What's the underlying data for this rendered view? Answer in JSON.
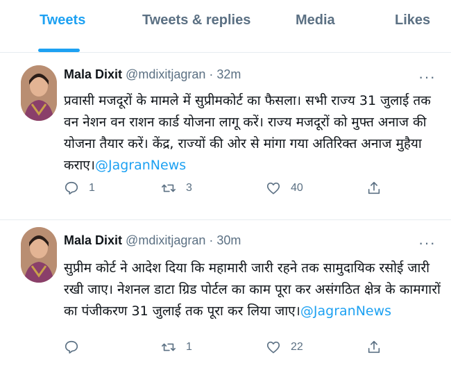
{
  "tabs": [
    {
      "label": "Tweets",
      "active": true
    },
    {
      "label": "Tweets & replies",
      "active": false
    },
    {
      "label": "Media",
      "active": false
    },
    {
      "label": "Likes",
      "active": false
    }
  ],
  "accent_color": "#1da1f2",
  "tweets": [
    {
      "name": "Mala Dixit",
      "handle": "@mdixitjagran",
      "time": "· 32m",
      "more": "···",
      "body": "प्रवासी मजदूरों के मामले में सुप्रीमकोर्ट का फैसला। सभी राज्य 31 जुलाई तक वन नेशन वन राशन कार्ड योजना लागू करें। राज्य मजदूरों को मुफ्त अनाज की योजना तैयार करें। केंद्र, राज्यों की ओर से मांगा गया अतिरिक्त अनाज मुहैया कराए।",
      "mention": "@JagranNews",
      "replies": "1",
      "retweets": "3",
      "likes": "40",
      "icons": [
        "reply-icon",
        "retweet-icon",
        "like-icon",
        "share-icon"
      ]
    },
    {
      "name": "Mala Dixit",
      "handle": "@mdixitjagran",
      "time": "· 30m",
      "more": "···",
      "body": "सुप्रीम कोर्ट ने आदेश दिया कि महामारी जारी रहने तक सामुदायिक रसोई जारी रखी जाए। नेशनल डाटा ग्रिड पोर्टल का काम पूरा कर असंगठित क्षेत्र के कामगारों का पंजीकरण 31 जुलाई तक पूरा कर लिया जाए।",
      "mention": "@JagranNews",
      "replies": "",
      "retweets": "1",
      "likes": "22",
      "icons": [
        "reply-icon",
        "retweet-icon",
        "like-icon",
        "share-icon"
      ]
    }
  ]
}
